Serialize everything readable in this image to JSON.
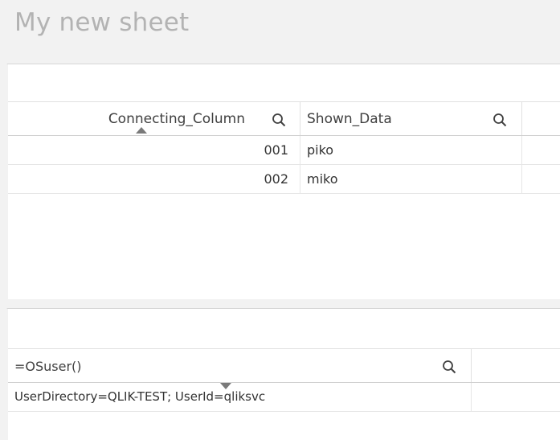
{
  "sheet": {
    "title": "My new sheet"
  },
  "table1": {
    "columns": [
      {
        "label": "Connecting_Column"
      },
      {
        "label": "Shown_Data"
      }
    ],
    "rows": [
      {
        "connecting_column": "001",
        "shown_data": "piko"
      },
      {
        "connecting_column": "002",
        "shown_data": "miko"
      }
    ]
  },
  "table2": {
    "columns": [
      {
        "label": "=OSuser()"
      }
    ],
    "rows": [
      {
        "value": "UserDirectory=QLIK-TEST; UserId=qliksvc"
      }
    ]
  },
  "icons": {
    "search": "search-icon",
    "sort_ascending": "sort-ascending-icon",
    "sort_descending": "sort-descending-icon"
  },
  "colors": {
    "background": "#f2f2f2",
    "panel": "#ffffff",
    "title_text": "#b3b3b3"
  }
}
